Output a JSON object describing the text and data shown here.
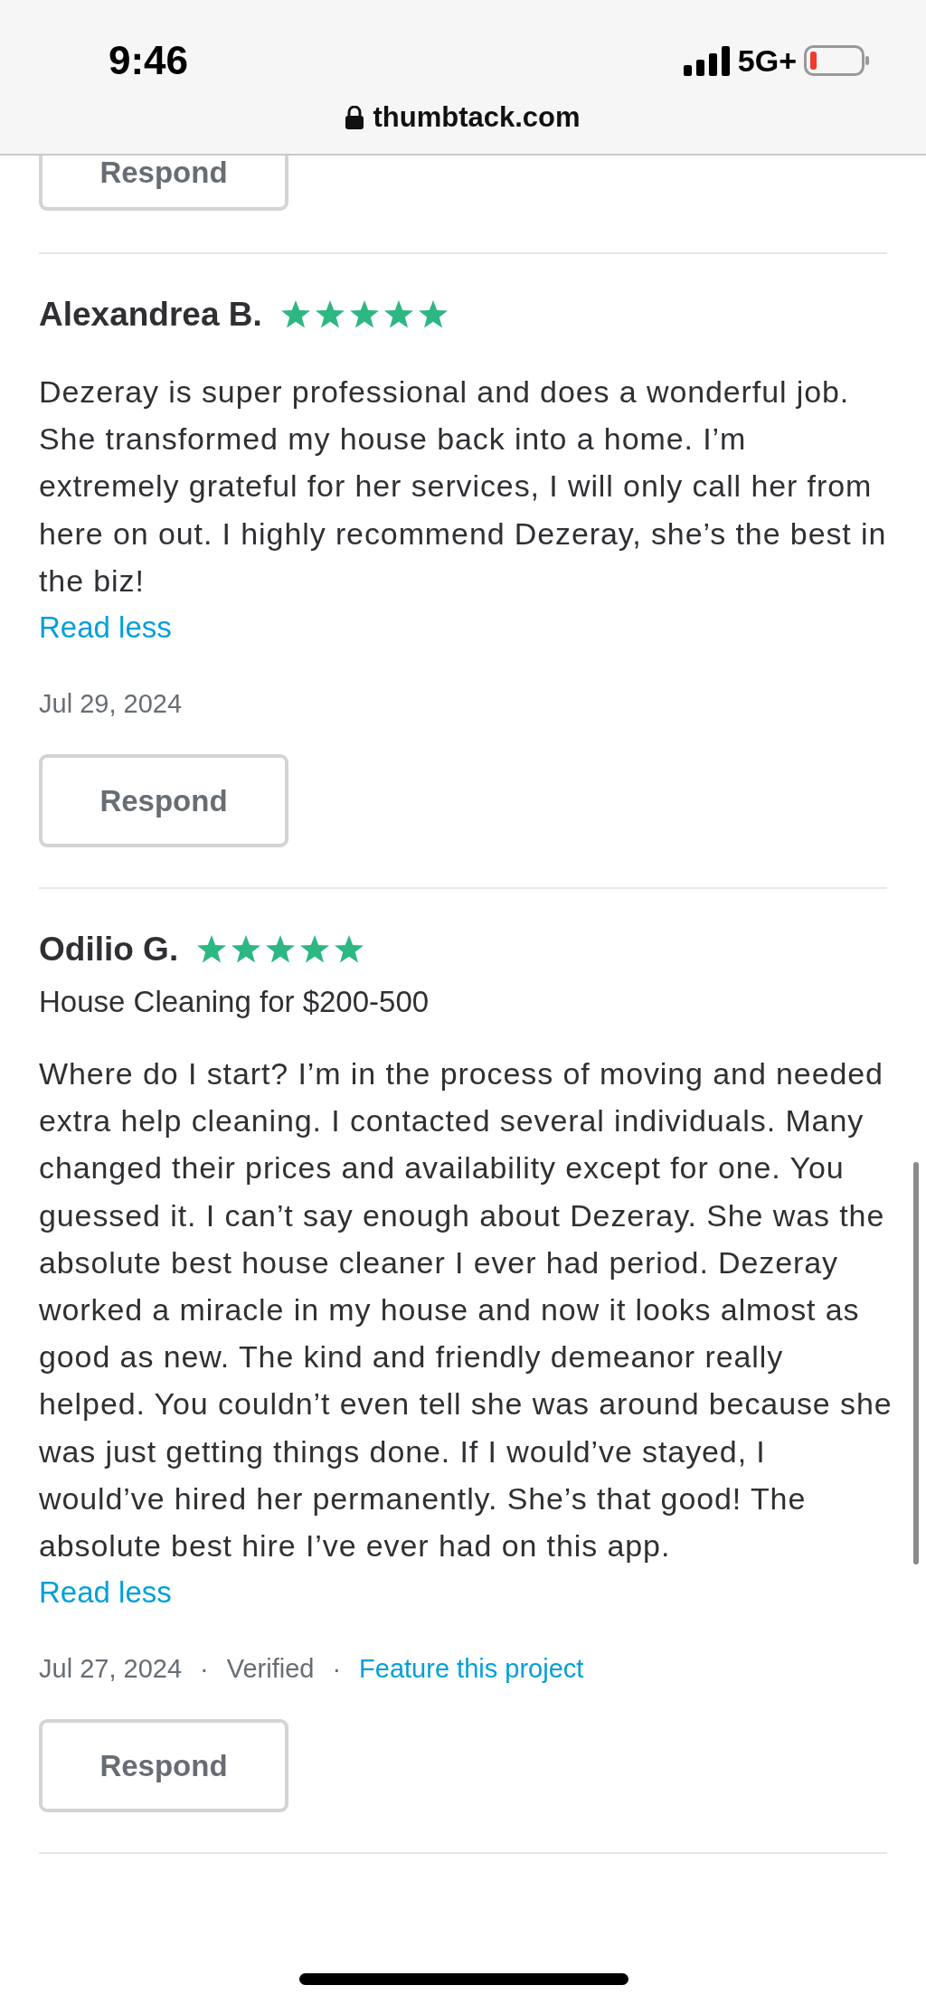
{
  "status_bar": {
    "time": "9:46",
    "network": "5G+"
  },
  "address_bar": {
    "url": "thumbtack.com"
  },
  "previous_review": {
    "respond_button": "Respond"
  },
  "reviews": [
    {
      "name": "Alexandrea B.",
      "stars": 5,
      "text": "Dezeray is super professional and does a wonderful job. She transformed my house back into a home. I’m extremely grateful for her services, I will only call her from here on out. I highly recommend Dezeray, she’s the best in the biz!",
      "toggle": "Read less",
      "meta": [
        {
          "kind": "date",
          "text": "Jul 29, 2024"
        }
      ],
      "respond_button": "Respond"
    },
    {
      "name": "Odilio G.",
      "stars": 5,
      "service": "House Cleaning for $200-500",
      "text": "Where do I start? I’m in the process of moving and needed extra help cleaning. I contacted several individuals. Many changed their prices and availability except for one. You guessed it. I can’t say enough about Dezeray. She was the absolute best house cleaner I ever had period. Dezeray worked a miracle in my house and now it looks almost as good as new. The kind and friendly demeanor really helped. You couldn’t even tell she was around because she was just getting things done. If I would’ve stayed, I would’ve hired her permanently. She’s that good! The absolute best hire I’ve ever had on this app.",
      "toggle": "Read less",
      "meta": [
        {
          "kind": "date",
          "text": "Jul 27, 2024"
        },
        {
          "kind": "separator",
          "text": "·"
        },
        {
          "kind": "status",
          "text": "Verified"
        },
        {
          "kind": "separator",
          "text": "·"
        },
        {
          "kind": "link",
          "text": "Feature this project"
        }
      ],
      "respond_button": "Respond"
    }
  ]
}
